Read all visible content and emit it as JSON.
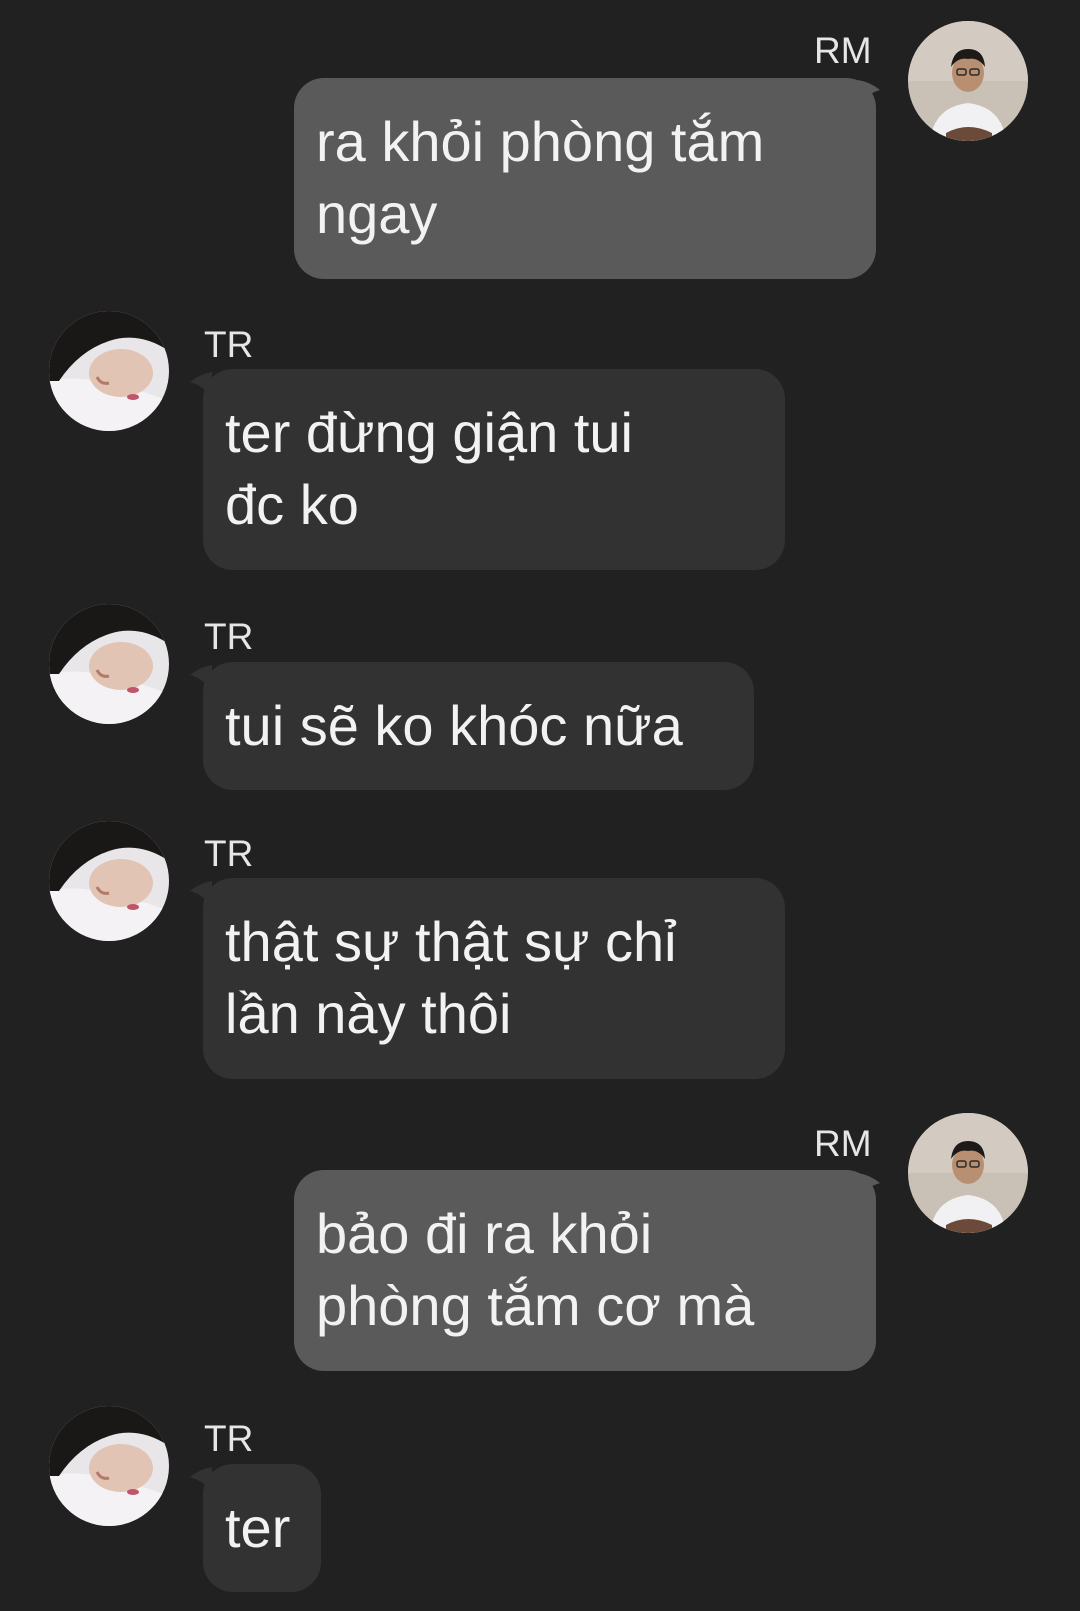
{
  "colors": {
    "background": "#212121",
    "outgoing_bubble": "#5a5a5a",
    "incoming_bubble": "#323232",
    "text": "#f2f2f2"
  },
  "messages": [
    {
      "sender": "RM",
      "direction": "outgoing",
      "avatar": "avatar-rm-photo",
      "lines": [
        "ra khỏi phòng tắm",
        "ngay"
      ]
    },
    {
      "sender": "TR",
      "direction": "incoming",
      "avatar": "avatar-tr-photo",
      "lines": [
        "ter đừng giận tui",
        "đc ko"
      ]
    },
    {
      "sender": "TR",
      "direction": "incoming",
      "avatar": "avatar-tr-photo",
      "lines": [
        "tui sẽ ko khóc nữa"
      ]
    },
    {
      "sender": "TR",
      "direction": "incoming",
      "avatar": "avatar-tr-photo",
      "lines": [
        "thật sự thật sự chỉ",
        "lần này thôi"
      ]
    },
    {
      "sender": "RM",
      "direction": "outgoing",
      "avatar": "avatar-rm-photo",
      "lines": [
        "bảo đi ra khỏi",
        "phòng tắm cơ mà"
      ]
    },
    {
      "sender": "TR",
      "direction": "incoming",
      "avatar": "avatar-tr-photo",
      "lines": [
        "ter"
      ]
    }
  ]
}
